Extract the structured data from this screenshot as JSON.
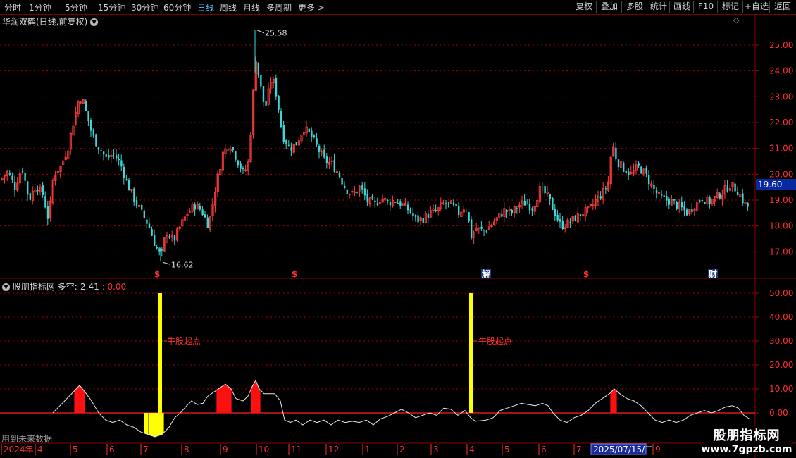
{
  "toolbar": {
    "periods": [
      "分时",
      "1分钟",
      "5分钟",
      "15分钟",
      "30分钟",
      "60分钟",
      "日线",
      "周线",
      "月线",
      "多周期",
      "更多"
    ],
    "active_period": "日线",
    "more_arrow": ">",
    "buttons": [
      "复权",
      "叠加",
      "多股",
      "统计",
      "画线",
      "F10",
      "标记",
      "+自选",
      "返回"
    ]
  },
  "main_chart": {
    "title": "华润双鹤(日线,前复权)",
    "y_ticks": [
      "25.00",
      "24.00",
      "23.00",
      "22.00",
      "21.00",
      "20.00",
      "19.00",
      "18.00",
      "17.00"
    ],
    "current_price": "19.60",
    "high_label": "25.58",
    "low_label": "16.62",
    "markers": [
      {
        "text": "$",
        "color": "#ff3030"
      },
      {
        "text": "$",
        "color": "#ff3030"
      },
      {
        "text": "解",
        "color": "#ffffff"
      },
      {
        "text": "$",
        "color": "#ff3030"
      },
      {
        "text": "财",
        "color": "#ffffff"
      }
    ]
  },
  "indicator": {
    "title": "股朋指标网",
    "label": "多空:",
    "value": "-2.41",
    "value2": ": 0.00",
    "y_ticks": [
      "50.00",
      "40.00",
      "30.00",
      "20.00",
      "10.00",
      "0.00"
    ],
    "signal_text": "牛股起点",
    "future_note": "用到未来数据"
  },
  "x_axis": {
    "labels": [
      "2024年",
      "4",
      "5",
      "6",
      "7",
      "8",
      "9",
      "10",
      "11",
      "12",
      "1",
      "2",
      "3",
      "4",
      "5",
      "6",
      "7",
      "2025/07/15/二",
      "9"
    ]
  },
  "watermark": {
    "title": "股朋指标网",
    "url": "www.7gpzb.com"
  },
  "colors": {
    "up": "#ff3c3c",
    "down": "#3cd8d8",
    "grid": "#a00000",
    "axis_text": "#ff3030",
    "signal": "#ffff00"
  },
  "chart_data": {
    "type": "candlestick",
    "price_range": [
      16.6,
      25.6
    ],
    "price_points": [
      [
        0,
        19.8
      ],
      [
        10,
        20.1
      ],
      [
        20,
        19.5
      ],
      [
        30,
        20.3
      ],
      [
        40,
        19.0
      ],
      [
        50,
        19.6
      ],
      [
        60,
        19.2
      ],
      [
        68,
        18.2
      ],
      [
        75,
        20.0
      ],
      [
        85,
        20.3
      ],
      [
        95,
        21.0
      ],
      [
        103,
        22.0
      ],
      [
        110,
        22.8
      ],
      [
        115,
        23.0
      ],
      [
        120,
        22.5
      ],
      [
        130,
        21.5
      ],
      [
        140,
        21.0
      ],
      [
        150,
        20.6
      ],
      [
        160,
        20.8
      ],
      [
        170,
        20.4
      ],
      [
        180,
        19.6
      ],
      [
        190,
        19.0
      ],
      [
        200,
        18.5
      ],
      [
        210,
        18.0
      ],
      [
        220,
        17.2
      ],
      [
        228,
        16.8
      ],
      [
        235,
        17.8
      ],
      [
        245,
        17.4
      ],
      [
        255,
        18.0
      ],
      [
        265,
        18.5
      ],
      [
        275,
        18.8
      ],
      [
        285,
        18.6
      ],
      [
        295,
        18.0
      ],
      [
        305,
        19.5
      ],
      [
        315,
        20.8
      ],
      [
        325,
        21.2
      ],
      [
        335,
        20.6
      ],
      [
        345,
        20.0
      ],
      [
        352,
        20.5
      ],
      [
        358,
        23.0
      ],
      [
        362,
        24.5
      ],
      [
        368,
        23.5
      ],
      [
        375,
        22.5
      ],
      [
        385,
        23.8
      ],
      [
        392,
        23.0
      ],
      [
        400,
        21.5
      ],
      [
        410,
        21.0
      ],
      [
        420,
        21.2
      ],
      [
        430,
        21.8
      ],
      [
        440,
        21.5
      ],
      [
        450,
        21.0
      ],
      [
        460,
        20.5
      ],
      [
        470,
        20.4
      ],
      [
        480,
        20.0
      ],
      [
        490,
        19.4
      ],
      [
        500,
        19.2
      ],
      [
        510,
        19.5
      ],
      [
        520,
        19.0
      ],
      [
        530,
        18.8
      ],
      [
        540,
        19.1
      ],
      [
        550,
        18.9
      ],
      [
        560,
        19.0
      ],
      [
        570,
        18.8
      ],
      [
        580,
        18.6
      ],
      [
        590,
        18.2
      ],
      [
        600,
        18.3
      ],
      [
        610,
        18.5
      ],
      [
        620,
        18.6
      ],
      [
        630,
        18.9
      ],
      [
        640,
        18.8
      ],
      [
        650,
        18.5
      ],
      [
        660,
        18.8
      ],
      [
        668,
        17.6
      ],
      [
        675,
        17.9
      ],
      [
        685,
        17.8
      ],
      [
        695,
        18.0
      ],
      [
        705,
        18.3
      ],
      [
        715,
        18.6
      ],
      [
        725,
        18.5
      ],
      [
        735,
        18.8
      ],
      [
        745,
        18.9
      ],
      [
        755,
        18.7
      ],
      [
        765,
        19.4
      ],
      [
        775,
        19.2
      ],
      [
        785,
        18.6
      ],
      [
        795,
        18.0
      ],
      [
        805,
        18.1
      ],
      [
        815,
        18.3
      ],
      [
        825,
        18.5
      ],
      [
        835,
        18.6
      ],
      [
        845,
        19.0
      ],
      [
        855,
        19.3
      ],
      [
        862,
        19.6
      ],
      [
        868,
        21.2
      ],
      [
        875,
        20.5
      ],
      [
        885,
        20.2
      ],
      [
        895,
        20.0
      ],
      [
        905,
        20.3
      ],
      [
        915,
        20.0
      ],
      [
        925,
        19.5
      ],
      [
        935,
        19.1
      ],
      [
        945,
        19.0
      ],
      [
        955,
        18.9
      ],
      [
        965,
        18.7
      ],
      [
        975,
        18.5
      ],
      [
        985,
        18.8
      ],
      [
        995,
        19.1
      ],
      [
        1005,
        18.9
      ],
      [
        1015,
        19.1
      ],
      [
        1025,
        19.3
      ],
      [
        1035,
        19.6
      ],
      [
        1045,
        19.4
      ],
      [
        1055,
        18.9
      ],
      [
        1062,
        18.7
      ]
    ],
    "indicator_range": [
      -10,
      52
    ],
    "indicator_points": [
      [
        75,
        0
      ],
      [
        85,
        3
      ],
      [
        95,
        6
      ],
      [
        105,
        9
      ],
      [
        113,
        11.5
      ],
      [
        120,
        9
      ],
      [
        130,
        5
      ],
      [
        140,
        0
      ],
      [
        150,
        -3
      ],
      [
        160,
        -4
      ],
      [
        170,
        -3
      ],
      [
        180,
        -5
      ],
      [
        190,
        -6
      ],
      [
        200,
        -8
      ],
      [
        210,
        -9
      ],
      [
        220,
        -10
      ],
      [
        230,
        -9
      ],
      [
        240,
        -6
      ],
      [
        248,
        -2
      ],
      [
        256,
        0
      ],
      [
        265,
        3
      ],
      [
        272,
        5
      ],
      [
        280,
        3.5
      ],
      [
        288,
        4
      ],
      [
        295,
        7
      ],
      [
        305,
        9
      ],
      [
        315,
        11
      ],
      [
        320,
        12
      ],
      [
        328,
        10
      ],
      [
        335,
        6
      ],
      [
        345,
        5
      ],
      [
        352,
        7
      ],
      [
        358,
        11
      ],
      [
        363,
        13.5
      ],
      [
        368,
        10
      ],
      [
        375,
        8
      ],
      [
        382,
        8
      ],
      [
        390,
        8
      ],
      [
        398,
        5
      ],
      [
        404,
        -3
      ],
      [
        412,
        -4
      ],
      [
        420,
        -3
      ],
      [
        430,
        -5
      ],
      [
        440,
        -3
      ],
      [
        450,
        -4
      ],
      [
        460,
        -3
      ],
      [
        470,
        -5
      ],
      [
        480,
        -3
      ],
      [
        490,
        -4
      ],
      [
        500,
        -3.5
      ],
      [
        510,
        -4
      ],
      [
        520,
        -3
      ],
      [
        530,
        -5
      ],
      [
        540,
        -2.5
      ],
      [
        550,
        -1.5
      ],
      [
        560,
        0
      ],
      [
        570,
        1.5
      ],
      [
        580,
        0
      ],
      [
        590,
        -2
      ],
      [
        600,
        -1
      ],
      [
        610,
        0
      ],
      [
        620,
        -1
      ],
      [
        630,
        2
      ],
      [
        640,
        1.5
      ],
      [
        650,
        -1
      ],
      [
        660,
        1
      ],
      [
        668,
        -2
      ],
      [
        675,
        -3.5
      ],
      [
        690,
        -3
      ],
      [
        700,
        -2
      ],
      [
        710,
        1
      ],
      [
        720,
        2
      ],
      [
        730,
        3
      ],
      [
        740,
        4
      ],
      [
        750,
        3.5
      ],
      [
        760,
        3
      ],
      [
        770,
        4
      ],
      [
        778,
        3
      ],
      [
        785,
        0
      ],
      [
        795,
        -3
      ],
      [
        805,
        -4
      ],
      [
        815,
        -2
      ],
      [
        825,
        -1
      ],
      [
        835,
        1
      ],
      [
        845,
        4
      ],
      [
        855,
        6
      ],
      [
        865,
        8
      ],
      [
        872,
        10
      ],
      [
        880,
        8
      ],
      [
        890,
        6
      ],
      [
        900,
        5
      ],
      [
        910,
        3
      ],
      [
        920,
        0
      ],
      [
        930,
        -3
      ],
      [
        940,
        -4
      ],
      [
        950,
        -3
      ],
      [
        960,
        -4
      ],
      [
        970,
        -3
      ],
      [
        980,
        -1
      ],
      [
        990,
        0
      ],
      [
        1000,
        1
      ],
      [
        1010,
        0
      ],
      [
        1020,
        1
      ],
      [
        1030,
        2.5
      ],
      [
        1040,
        3
      ],
      [
        1048,
        2
      ],
      [
        1056,
        -1
      ],
      [
        1064,
        -2.5
      ]
    ],
    "red_blocks": [
      {
        "from": 106,
        "to": 120,
        "height": 11.5
      },
      {
        "from": 308,
        "to": 328,
        "height": 12
      },
      {
        "from": 357,
        "to": 369,
        "height": 13.5
      },
      {
        "from": 867,
        "to": 875,
        "height": 10
      }
    ],
    "yellow_blocks": [
      {
        "from": 205,
        "to": 210,
        "height": -8
      },
      {
        "from": 212,
        "to": 232,
        "height": -10
      }
    ],
    "signals": [
      {
        "x": 227,
        "height": 50
      },
      {
        "x": 669,
        "height": 50
      }
    ]
  }
}
